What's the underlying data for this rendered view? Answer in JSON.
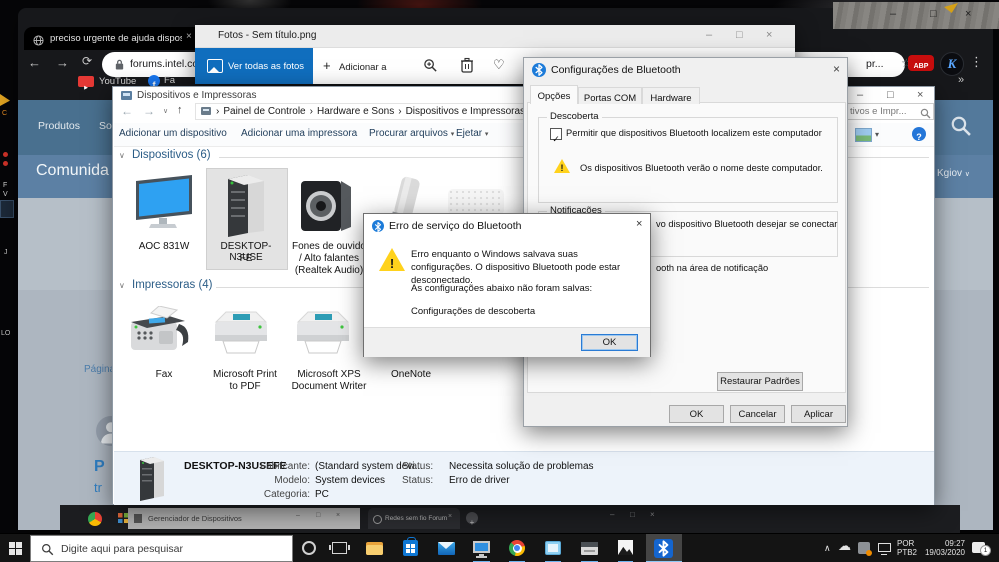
{
  "glyphs": {
    "min": "–",
    "max": "□",
    "close": "×",
    "back": "←",
    "fwd": "→",
    "up": "↑",
    "reload": "⟳",
    "star": "☆",
    "menu": "⋮",
    "more": "»",
    "heart": "♡",
    "plus": "+",
    "check": "✓",
    "excl": "!",
    "help": "?",
    "chev": "∨",
    "drop": "▾",
    "sep": "›",
    "play": "▶",
    "fb": "f",
    "k": "K",
    "cloud": "☁",
    "caret": "∧"
  },
  "chrome": {
    "tab_title": "preciso urgente de ajuda disposi",
    "url": "forums.intel.com/s/c",
    "url_fragment": "pr...",
    "abp": "ABP",
    "bookmark1": "YouTube",
    "bookmark2": "Fa"
  },
  "photos": {
    "title": "Fotos - Sem título.png",
    "view_all": "Ver todas as fotos",
    "add_to": "Adicionar a"
  },
  "devices": {
    "title": "Dispositivos e Impressoras",
    "crumb1": "Painel de Controle",
    "crumb2": "Hardware e Sons",
    "crumb3": "Dispositivos e Impressoras",
    "search_text": "tivos e Impr...",
    "add_device": "Adicionar um dispositivo",
    "add_printer": "Adicionar uma impressora",
    "browse": "Procurar arquivos",
    "eject": "Ejetar",
    "sec_devices": "Dispositivos (6)",
    "sec_printers": "Impressoras (4)",
    "dev1": "AOC 831W",
    "dev2a": "DESKTOP-N3USE",
    "dev2b": "FE",
    "dev3a": "Fones de ouvido",
    "dev3b": "/ Alto falantes",
    "dev3c": "(Realtek Audio)",
    "pr1": "Fax",
    "pr2a": "Microsoft Print",
    "pr2b": "to PDF",
    "pr3a": "Microsoft XPS",
    "pr3b": "Document Writer",
    "pr4": "OneNote",
    "det_name": "DESKTOP-N3USEFE",
    "lbl_fab": "Fabricante:",
    "val_fab": "(Standard system devi...",
    "lbl_mod": "Modelo:",
    "val_mod": "System devices",
    "lbl_cat": "Categoria:",
    "val_cat": "PC",
    "lbl_st1": "Status:",
    "val_st1": "Necessita solução de problemas",
    "lbl_st2": "Status:",
    "val_st2": "Erro de driver"
  },
  "bt": {
    "title": "Configurações de Bluetooth",
    "tab1": "Opções",
    "tab2": "Portas COM",
    "tab3": "Hardware",
    "grp1": "Descoberta",
    "chk1": "Permitir que dispositivos Bluetooth localizem este computador",
    "warn": "Os dispositivos Bluetooth verão o nome deste computador.",
    "grp2": "Notificações",
    "frag1": "vo dispositivo Bluetooth desejar se conectar",
    "frag2": "ooth na área de notificação",
    "restore": "Restaurar Padrões",
    "ok": "OK",
    "cancel": "Cancelar",
    "apply": "Aplicar"
  },
  "err": {
    "title": "Erro de serviço do Bluetooth",
    "line1": "Erro enquanto o Windows salvava suas configurações. O dispositivo Bluetooth pode estar desconectado.",
    "line2": "As configurações abaixo não foram salvas:",
    "line3": "Configurações de descoberta",
    "ok": "OK"
  },
  "intel": {
    "nav1": "Produtos",
    "nav2": "So",
    "heading": "Comunida",
    "user": "Kgiov",
    "pagina": "Página",
    "frag_p": "P",
    "frag_tr": "tr"
  },
  "strip": {
    "devmgr": "Gerenciador de Dispositivos",
    "tab": "Redes sem fio Forum"
  },
  "taskbar": {
    "search": "Digite aqui para pesquisar",
    "lang1": "POR",
    "lang2": "PTB2",
    "time": "09:27",
    "date": "19/03/2020",
    "badge": "1"
  },
  "desktop": {
    "f1": "C",
    "f2": "F",
    "f3": "V",
    "f4": "J",
    "f5": "LO"
  }
}
